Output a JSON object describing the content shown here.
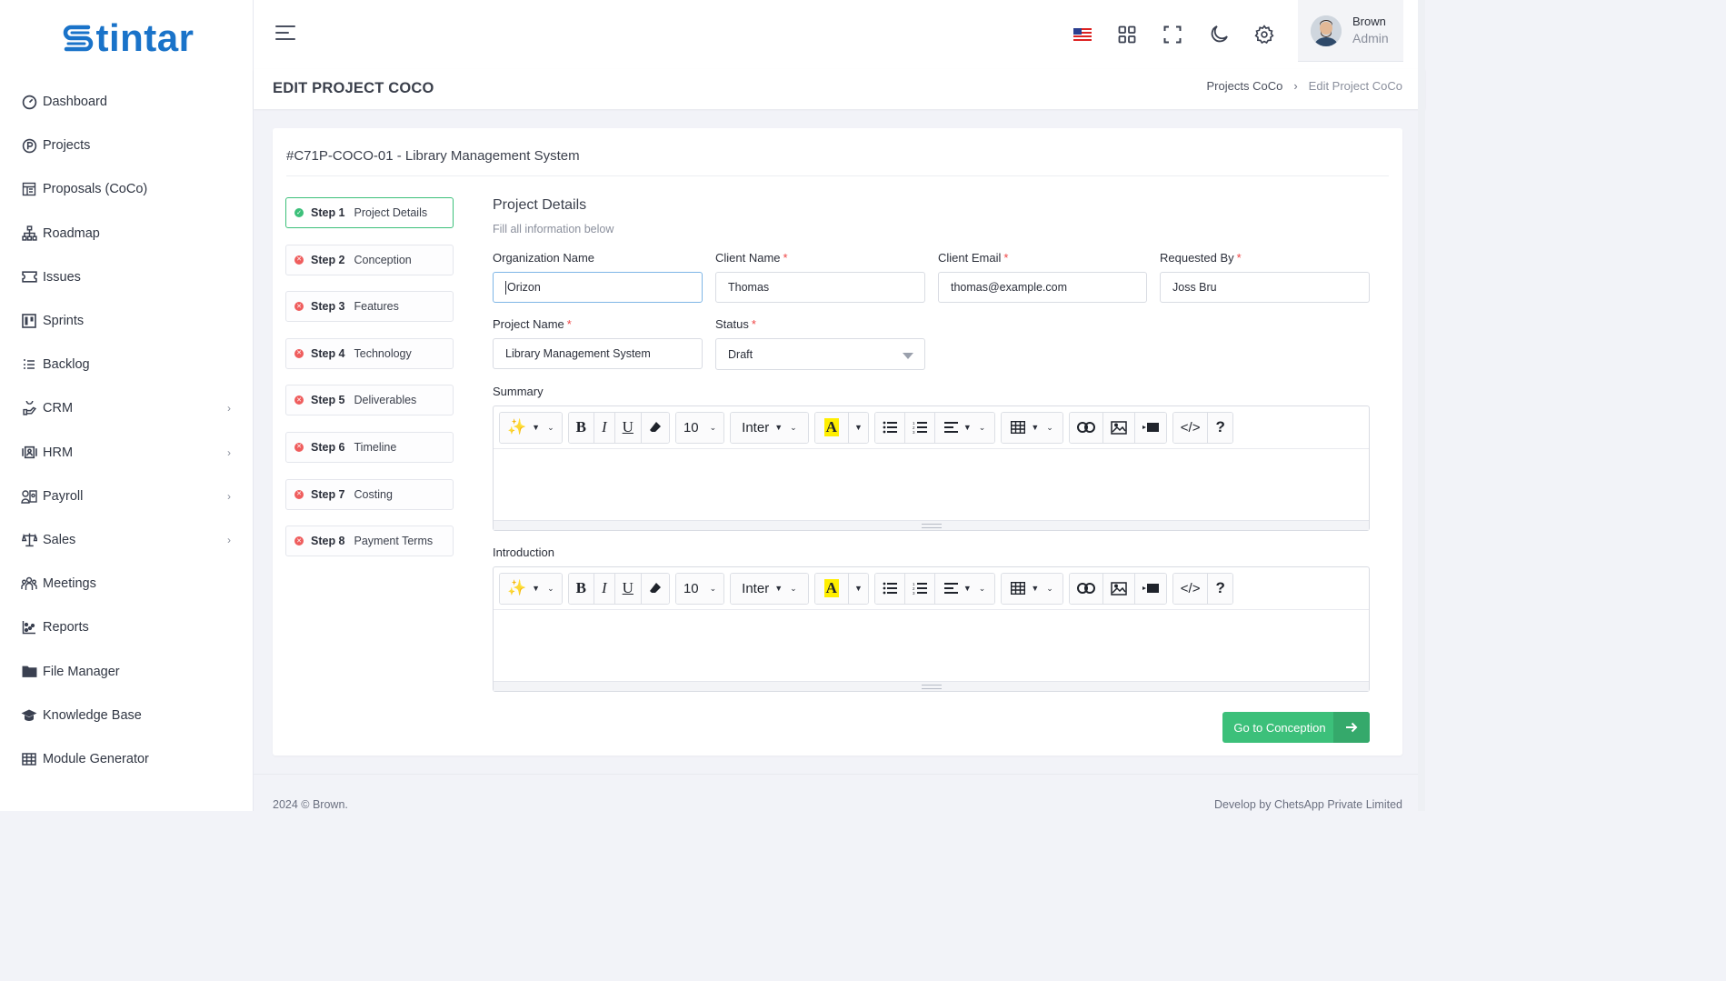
{
  "brand": {
    "name": "tintar",
    "color": "#1a73c9"
  },
  "sidebar": {
    "items": [
      {
        "label": "Dashboard",
        "icon": "speedometer-icon",
        "has_children": false
      },
      {
        "label": "Projects",
        "icon": "p-circle-icon",
        "has_children": false
      },
      {
        "label": "Proposals (CoCo)",
        "icon": "layout-icon",
        "has_children": false
      },
      {
        "label": "Roadmap",
        "icon": "sitemap-icon",
        "has_children": false
      },
      {
        "label": "Issues",
        "icon": "ticket-icon",
        "has_children": false
      },
      {
        "label": "Sprints",
        "icon": "kanban-icon",
        "has_children": false
      },
      {
        "label": "Backlog",
        "icon": "list-icon",
        "has_children": false
      },
      {
        "label": "CRM",
        "icon": "hand-icon",
        "has_children": true
      },
      {
        "label": "HRM",
        "icon": "id-card-icon",
        "has_children": true
      },
      {
        "label": "Payroll",
        "icon": "user-payroll-icon",
        "has_children": true
      },
      {
        "label": "Sales",
        "icon": "scale-icon",
        "has_children": true
      },
      {
        "label": "Meetings",
        "icon": "people-icon",
        "has_children": false
      },
      {
        "label": "Reports",
        "icon": "chart-icon",
        "has_children": false
      },
      {
        "label": "File Manager",
        "icon": "folder-icon",
        "has_children": false
      },
      {
        "label": "Knowledge Base",
        "icon": "graduation-cap-icon",
        "has_children": false
      },
      {
        "label": "Module Generator",
        "icon": "grid-icon",
        "has_children": false
      }
    ]
  },
  "header": {
    "user": {
      "name": "Brown",
      "role": "Admin"
    }
  },
  "page": {
    "title": "EDIT PROJECT COCO",
    "breadcrumb": {
      "parent": "Projects CoCo",
      "current": "Edit Project CoCo"
    }
  },
  "card": {
    "title": "#C71P-COCO-01 - Library Management System",
    "steps": [
      {
        "num": "Step 1",
        "name": "Project Details",
        "status": "complete"
      },
      {
        "num": "Step 2",
        "name": "Conception",
        "status": "incomplete"
      },
      {
        "num": "Step 3",
        "name": "Features",
        "status": "incomplete"
      },
      {
        "num": "Step 4",
        "name": "Technology",
        "status": "incomplete"
      },
      {
        "num": "Step 5",
        "name": "Deliverables",
        "status": "incomplete"
      },
      {
        "num": "Step 6",
        "name": "Timeline",
        "status": "incomplete"
      },
      {
        "num": "Step 7",
        "name": "Costing",
        "status": "incomplete"
      },
      {
        "num": "Step 8",
        "name": "Payment Terms",
        "status": "incomplete"
      }
    ]
  },
  "form": {
    "section_title": "Project Details",
    "section_subtitle": "Fill all information below",
    "organization_name": {
      "label": "Organization Name",
      "value": "Orizon"
    },
    "client_name": {
      "label": "Client Name",
      "value": "Thomas"
    },
    "client_email": {
      "label": "Client Email",
      "value": "thomas@example.com"
    },
    "requested_by": {
      "label": "Requested By",
      "value": "Joss Bru"
    },
    "project_name": {
      "label": "Project Name",
      "value": "Library Management System"
    },
    "status": {
      "label": "Status",
      "value": "Draft"
    },
    "required_mark": "*",
    "summary": {
      "label": "Summary"
    },
    "introduction": {
      "label": "Introduction"
    },
    "toolbar": {
      "font_size": "10",
      "font_family": "Inter"
    },
    "next_button": "Go to Conception"
  },
  "footer": {
    "left": "2024 © Brown.",
    "right": "Develop by ChetsApp Private Limited"
  },
  "colors": {
    "accent_green": "#3cc07a",
    "error_red": "#ef5d5d",
    "highlight_yellow": "#ffee00"
  }
}
